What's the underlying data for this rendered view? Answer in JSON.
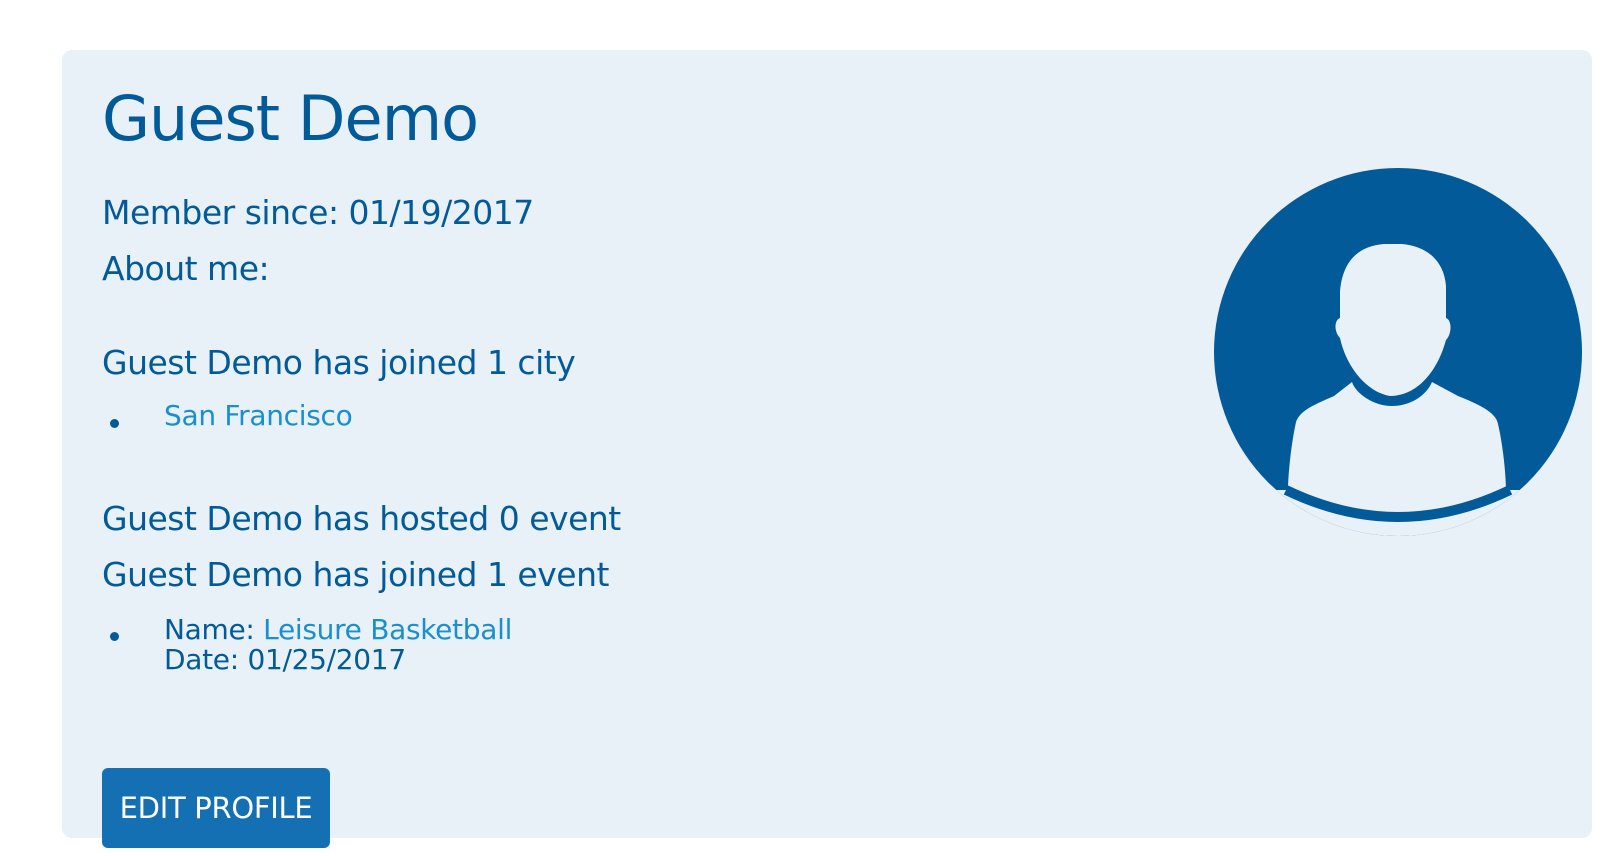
{
  "profile": {
    "name": "Guest Demo",
    "member_since": "Member since: 01/19/2017",
    "about_me": "About me:"
  },
  "cities": {
    "heading": "Guest Demo has joined 1 city",
    "items": [
      {
        "label": "San Francisco"
      }
    ]
  },
  "events": {
    "hosted_heading": "Guest Demo has hosted 0 event",
    "joined_heading": "Guest Demo has joined 1 event",
    "items": [
      {
        "name_prefix": "Name: ",
        "name": "Leisure Basketball",
        "date_line": "Date: 01/25/2017"
      }
    ]
  },
  "actions": {
    "edit_profile_label": "EDIT PROFILE"
  },
  "avatar": {
    "icon": "user-silhouette-icon",
    "color": "#025a99"
  },
  "theme": {
    "card_bg": "#e8f0f8",
    "text": "#025a99",
    "link": "#1a8fd0",
    "button_bg": "#1470b3"
  }
}
